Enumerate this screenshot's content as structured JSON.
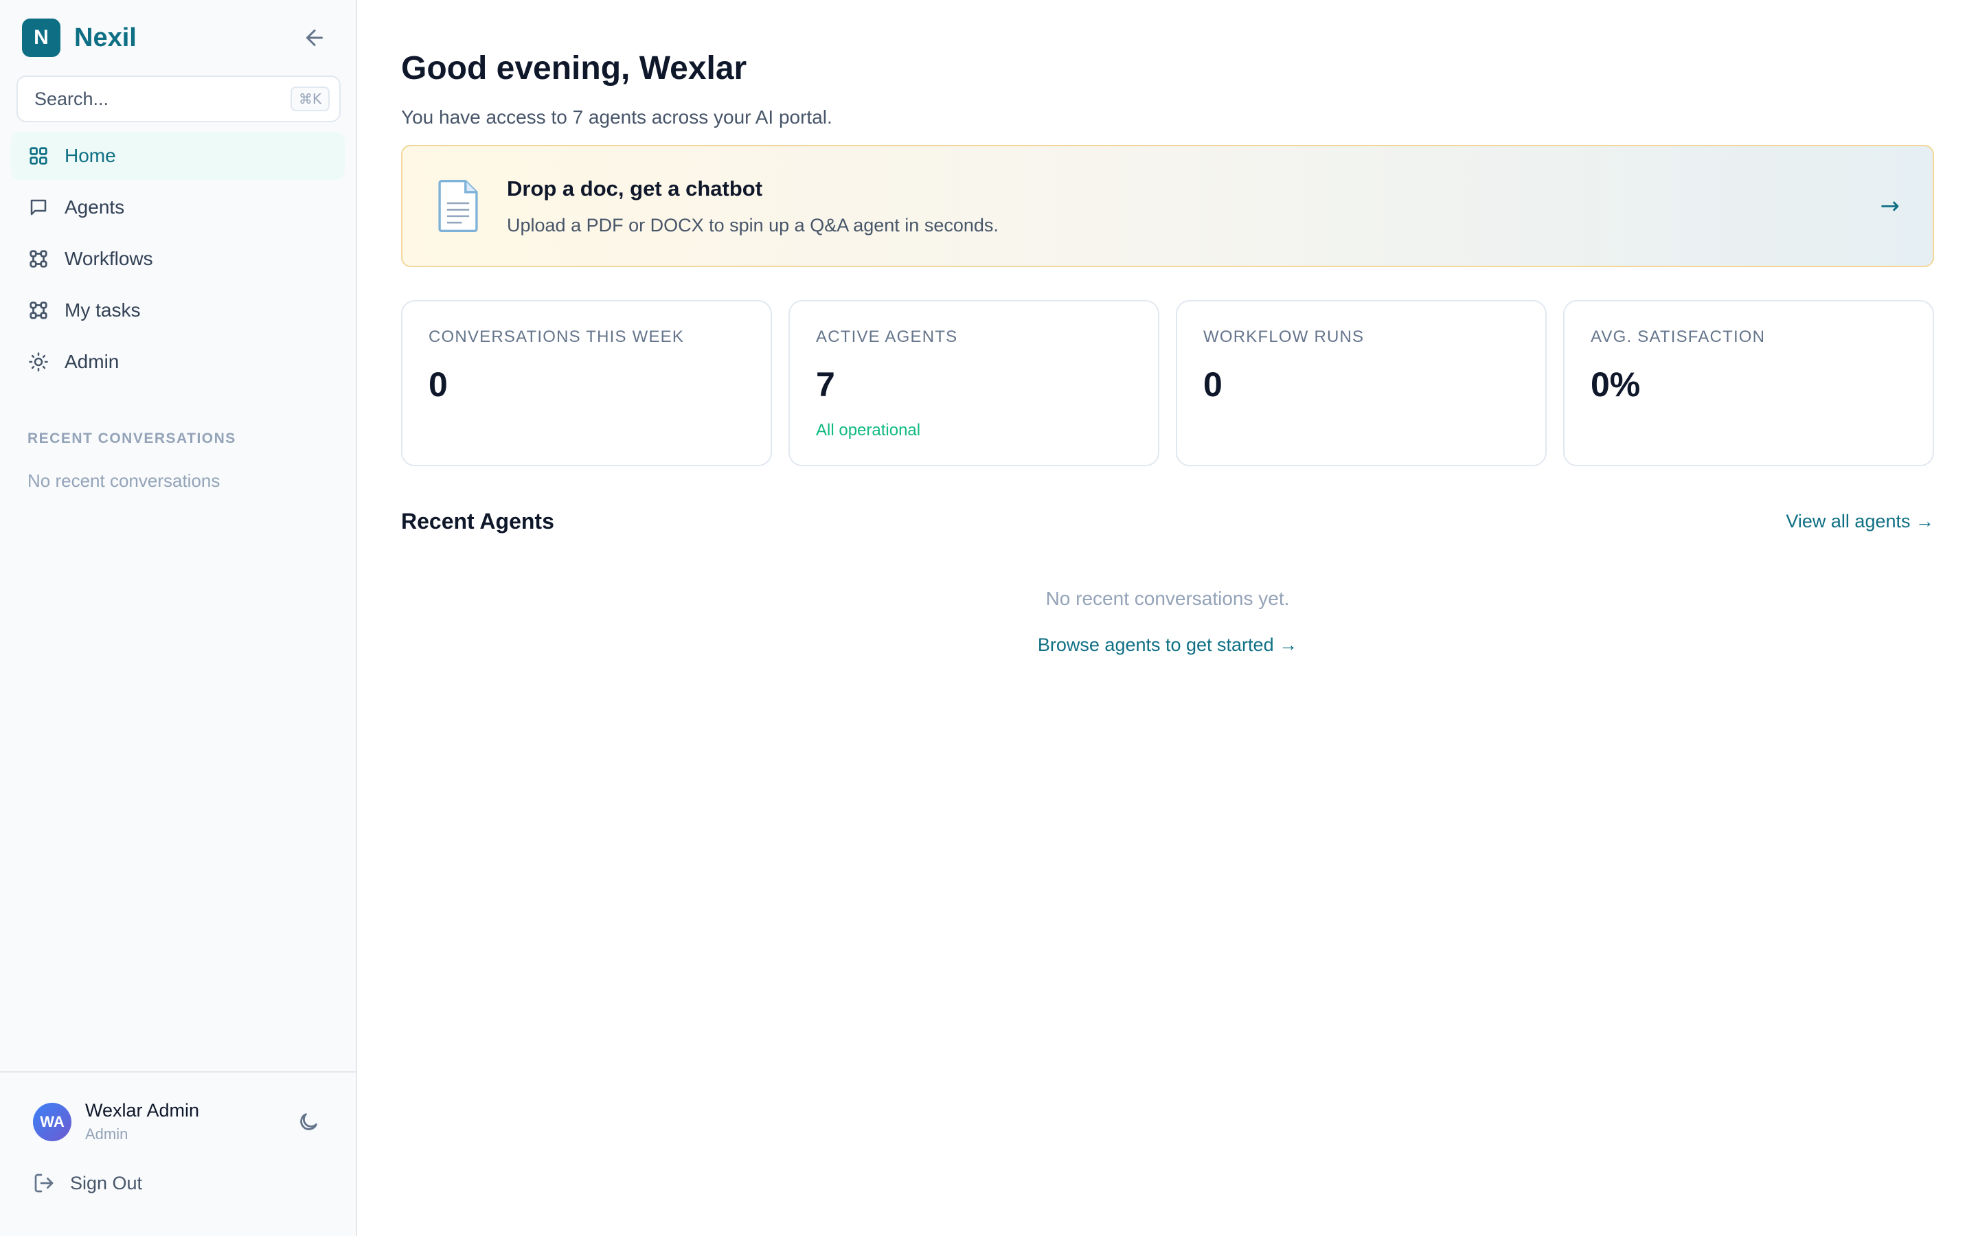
{
  "brand": {
    "logo_letter": "N",
    "name": "Nexil"
  },
  "search": {
    "placeholder": "Search...",
    "shortcut": "⌘K"
  },
  "nav": [
    {
      "label": "Home",
      "icon": "grid-icon",
      "active": true
    },
    {
      "label": "Agents",
      "icon": "chat-bubble-icon"
    },
    {
      "label": "Workflows",
      "icon": "workflow-icon"
    },
    {
      "label": "My tasks",
      "icon": "tasks-icon"
    },
    {
      "label": "Admin",
      "icon": "sun-gear-icon"
    }
  ],
  "recent": {
    "section_label": "RECENT CONVERSATIONS",
    "empty": "No recent conversations"
  },
  "user": {
    "initials": "WA",
    "name": "Wexlar Admin",
    "role": "Admin"
  },
  "signout": {
    "label": "Sign Out"
  },
  "main": {
    "greeting": "Good evening, Wexlar",
    "subtitle": "You have access to 7 agents across your AI portal.",
    "banner": {
      "title": "Drop a doc, get a chatbot",
      "desc": "Upload a PDF or DOCX to spin up a Q&A agent in seconds.",
      "arrow": "→"
    },
    "stats": [
      {
        "label": "CONVERSATIONS THIS WEEK",
        "value": "0",
        "note": ""
      },
      {
        "label": "ACTIVE AGENTS",
        "value": "7",
        "note": "All operational"
      },
      {
        "label": "WORKFLOW RUNS",
        "value": "0",
        "note": ""
      },
      {
        "label": "AVG. SATISFACTION",
        "value": "0%",
        "note": ""
      }
    ],
    "recent_agents": {
      "title": "Recent Agents",
      "view_all": "View all agents →",
      "empty": "No recent conversations yet.",
      "browse": "Browse agents to get started →"
    }
  },
  "colors": {
    "accent": "#0e6f84",
    "success": "#10b981",
    "banner_border": "#f2d79b"
  }
}
